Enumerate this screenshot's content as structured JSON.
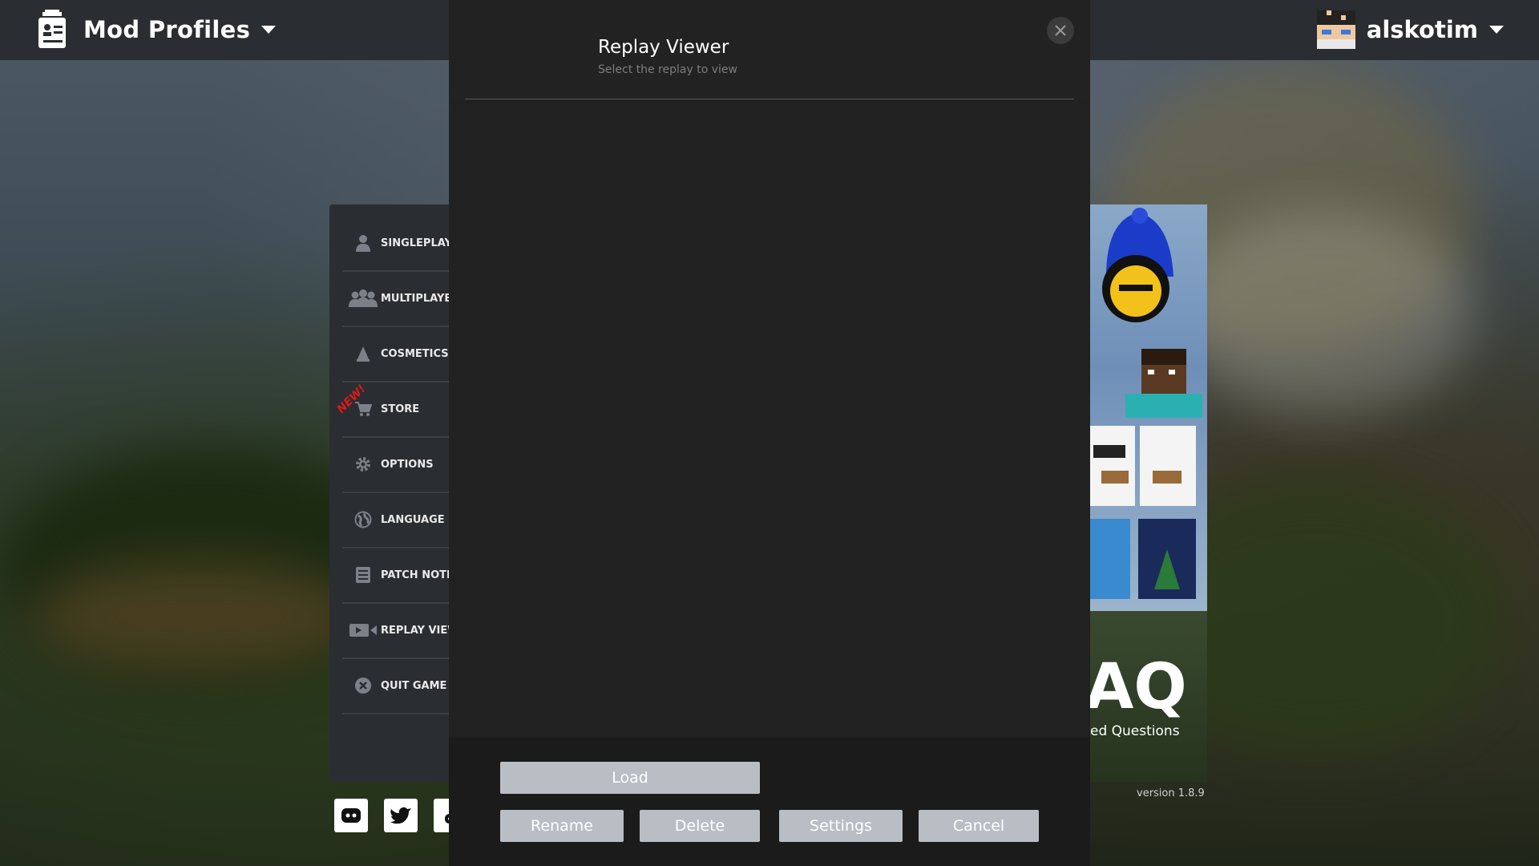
{
  "topbar": {
    "profiles_label": "Mod Profiles",
    "username": "alskotim"
  },
  "sidebar": {
    "new_badge": "NEW!",
    "items": [
      {
        "label": "SINGLEPLAY",
        "icon": "person-icon"
      },
      {
        "label": "MULTIPLAYE",
        "icon": "people-icon"
      },
      {
        "label": "COSMETICS",
        "icon": "hanger-icon"
      },
      {
        "label": "STORE",
        "icon": "cart-icon"
      },
      {
        "label": "OPTIONS",
        "icon": "gear-icon"
      },
      {
        "label": "LANGUAGE",
        "icon": "globe-icon"
      },
      {
        "label": "PATCH NOTE",
        "icon": "notes-icon"
      },
      {
        "label": "REPLAY VIEW",
        "icon": "camera-icon"
      },
      {
        "label": "QUIT GAME",
        "icon": "close-circle-icon"
      }
    ]
  },
  "promo": {
    "faq_big": "AQ",
    "faq_small": "ed Questions",
    "version": "version 1.8.9"
  },
  "modal": {
    "title": "Replay Viewer",
    "subtitle": "Select the replay to view",
    "buttons": {
      "load": "Load",
      "rename": "Rename",
      "delete": "Delete",
      "settings": "Settings",
      "cancel": "Cancel"
    }
  },
  "colors": {
    "topbar": "#2a2d31",
    "modal": "#222222",
    "button": "#b9bec5",
    "new_badge": "#e01818"
  }
}
